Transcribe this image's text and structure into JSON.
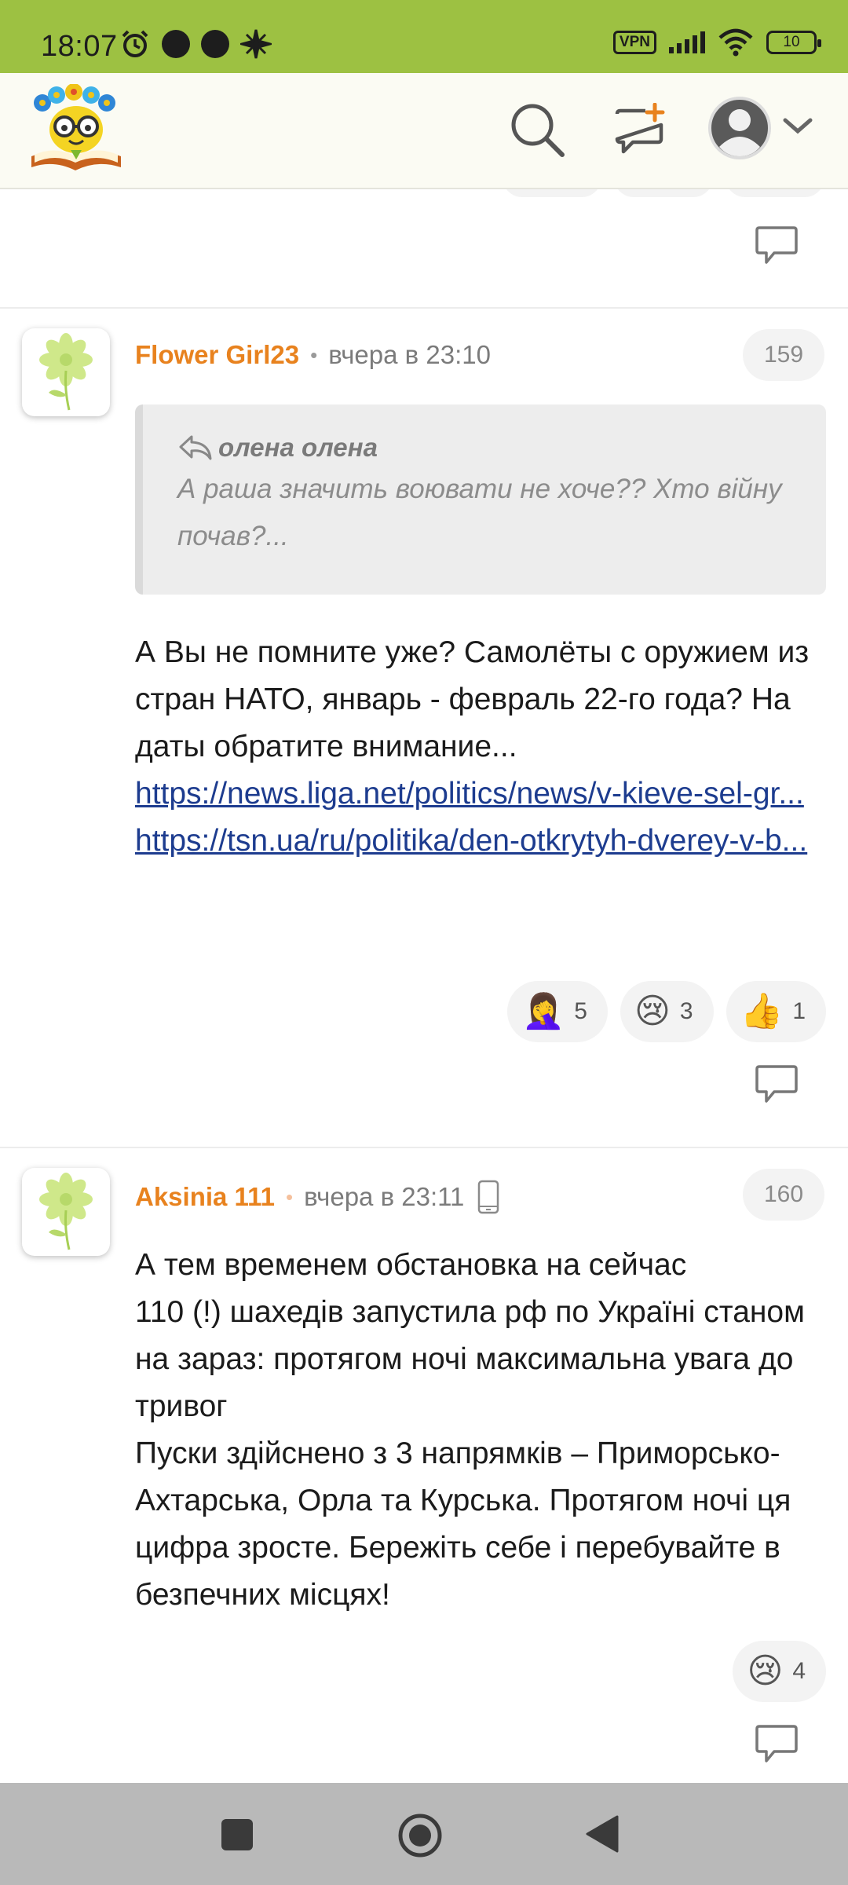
{
  "status_bar": {
    "time": "18:07",
    "vpn": "VPN",
    "battery": "10"
  },
  "header": {
    "logo": "site-logo",
    "search": "search-icon",
    "new_post": "new-post-icon",
    "account": "account-icon"
  },
  "comments": [
    {
      "author": "Flower Girl23",
      "time": "вчера в 23:10",
      "number": "159",
      "quote": {
        "author": "олена олена",
        "text": "А раша значить воювати не хоче?? Хто війну почав?..."
      },
      "text": "А Вы не помните уже? Самолёты с оружием из стран НАТО, январь - февраль 22-го года? На даты обратите внимание...",
      "links": [
        "https://news.liga.net/politics/news/v-kieve-sel-gr...",
        "https://tsn.ua/ru/politika/den-otkrytyh-dverey-v-b..."
      ],
      "reactions": [
        {
          "emoji": "🤦‍♀️",
          "count": "5"
        },
        {
          "emoji": "😢",
          "count": "3"
        },
        {
          "emoji": "👍",
          "count": "1"
        }
      ]
    },
    {
      "author": "Aksinia 111",
      "time": "вчера в 23:11",
      "number": "160",
      "text_lines": [
        "А тем временем обстановка на сейчас",
        "110 (!) шахедів запустила рф по Україні станом на зараз: протягом ночі максимальна увага до тривог",
        "Пуски здійснено з 3 напрямків – Приморсько-Ахтарська, Орла та Курська. Протягом ночі ця цифра зросте. Бережіть себе і перебувайте в безпечних місцях!"
      ],
      "reactions": [
        {
          "emoji": "😢",
          "count": "4"
        }
      ]
    }
  ],
  "colors": {
    "status_bar": "#9dc142",
    "author": "#e8821e",
    "link": "#1d3c8f"
  }
}
